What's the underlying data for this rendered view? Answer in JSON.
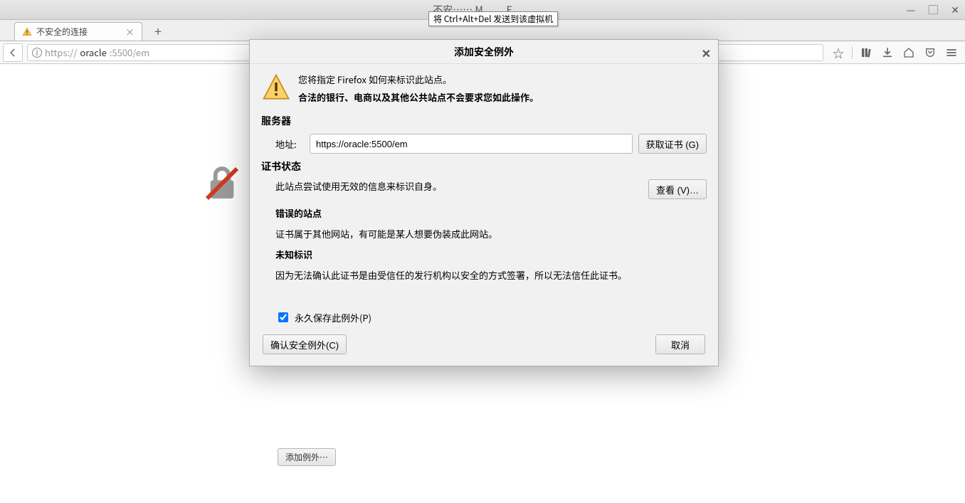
{
  "vm": {
    "title": "不安……  M……  F……",
    "tooltip": "将 Ctrl+Alt+Del 发送到该虚拟机"
  },
  "browser": {
    "tab_title": "不安全的连接",
    "url_proto": "https://",
    "url_host": "oracle",
    "url_port_path": ":5500/em"
  },
  "page": {
    "behind_button": "添加例外…"
  },
  "dialog": {
    "title": "添加安全例外",
    "msg1": "您将指定 Firefox 如何来标识此站点。",
    "msg2": "合法的银行、电商以及其他公共站点不会要求您如此操作。",
    "server_heading": "服务器",
    "address_label": "地址:",
    "address_value": "https://oracle:5500/em",
    "get_cert_btn": "获取证书 (G)",
    "cert_status_heading": "证书状态",
    "cert_status_text": "此站点尝试使用无效的信息来标识自身。",
    "view_btn": "查看 (V)…",
    "wrong_site_heading": "错误的站点",
    "wrong_site_text": "证书属于其他网站，有可能是某人想要伪装成此网站。",
    "unknown_heading": "未知标识",
    "unknown_text": "因为无法确认此证书是由受信任的发行机构以安全的方式签署，所以无法信任此证书。",
    "perm_label": "永久保存此例外(P)",
    "confirm_btn": "确认安全例外(C)",
    "cancel_btn": "取消"
  }
}
